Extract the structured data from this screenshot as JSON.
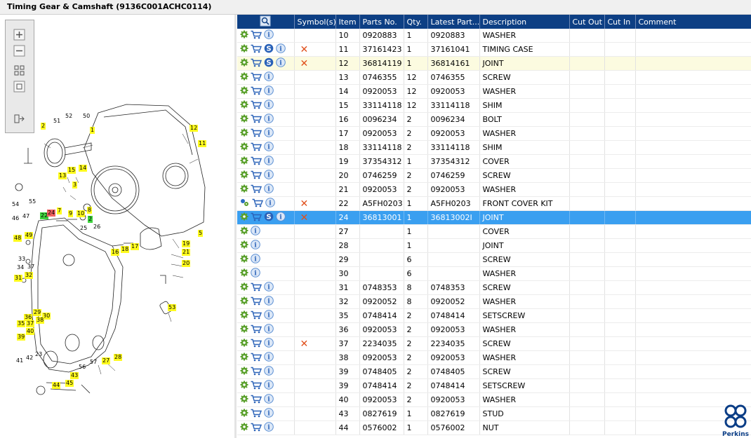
{
  "window": {
    "title": "Timing Gear & Camshaft (9136C001ACHC0114)"
  },
  "toolbar": {
    "buttons": [
      "zoom-in",
      "zoom-out",
      "fit-page",
      "actual-size",
      "toggle-panel"
    ]
  },
  "diagram": {
    "callouts": [
      {
        "text": "1",
        "style": "y"
      },
      {
        "text": "2",
        "style": "y"
      },
      {
        "text": "12",
        "style": "y"
      },
      {
        "text": "11",
        "style": "y"
      },
      {
        "text": "51",
        "style": "n"
      },
      {
        "text": "52",
        "style": "n"
      },
      {
        "text": "50",
        "style": "n"
      },
      {
        "text": "15",
        "style": "y"
      },
      {
        "text": "14",
        "style": "y"
      },
      {
        "text": "13",
        "style": "y"
      },
      {
        "text": "3",
        "style": "y"
      },
      {
        "text": "54",
        "style": "n"
      },
      {
        "text": "55",
        "style": "n"
      },
      {
        "text": "7",
        "style": "y"
      },
      {
        "text": "9",
        "style": "y"
      },
      {
        "text": "10",
        "style": "y"
      },
      {
        "text": "8",
        "style": "y"
      },
      {
        "text": "2",
        "style": "g"
      },
      {
        "text": "22",
        "style": "g"
      },
      {
        "text": "24",
        "style": "r"
      },
      {
        "text": "47",
        "style": "n"
      },
      {
        "text": "46",
        "style": "n"
      },
      {
        "text": "49",
        "style": "y"
      },
      {
        "text": "48",
        "style": "y"
      },
      {
        "text": "25",
        "style": "n"
      },
      {
        "text": "26",
        "style": "n"
      },
      {
        "text": "16",
        "style": "y"
      },
      {
        "text": "18",
        "style": "y"
      },
      {
        "text": "17",
        "style": "y"
      },
      {
        "text": "5",
        "style": "y"
      },
      {
        "text": "19",
        "style": "y"
      },
      {
        "text": "21",
        "style": "y"
      },
      {
        "text": "20",
        "style": "y"
      },
      {
        "text": "33",
        "style": "n"
      },
      {
        "text": "34",
        "style": "n"
      },
      {
        "text": "37",
        "style": "n"
      },
      {
        "text": "31",
        "style": "y"
      },
      {
        "text": "32",
        "style": "y"
      },
      {
        "text": "53",
        "style": "y"
      },
      {
        "text": "29",
        "style": "y"
      },
      {
        "text": "30",
        "style": "y"
      },
      {
        "text": "36",
        "style": "y"
      },
      {
        "text": "38",
        "style": "y"
      },
      {
        "text": "35",
        "style": "y"
      },
      {
        "text": "37",
        "style": "y"
      },
      {
        "text": "40",
        "style": "y"
      },
      {
        "text": "39",
        "style": "y"
      },
      {
        "text": "23",
        "style": "n"
      },
      {
        "text": "42",
        "style": "n"
      },
      {
        "text": "41",
        "style": "n"
      },
      {
        "text": "27",
        "style": "y"
      },
      {
        "text": "28",
        "style": "y"
      },
      {
        "text": "56",
        "style": "n"
      },
      {
        "text": "57",
        "style": "n"
      },
      {
        "text": "43",
        "style": "y"
      },
      {
        "text": "44",
        "style": "y"
      },
      {
        "text": "45",
        "style": "y"
      }
    ]
  },
  "table": {
    "columns": [
      "",
      "Symbol(s)",
      "Item",
      "Parts No.",
      "Qty.",
      "Latest Part...",
      "Description",
      "Cut Out",
      "Cut In",
      "Comment"
    ],
    "rows": [
      {
        "icons": [
          "gear",
          "cart",
          "info"
        ],
        "symbol": "",
        "item": "10",
        "part": "0920883",
        "qty": "1",
        "latest": "0920883",
        "desc": "WASHER"
      },
      {
        "icons": [
          "gear",
          "cart",
          "s",
          "info"
        ],
        "symbol": "x",
        "item": "11",
        "part": "37161423",
        "qty": "1",
        "latest": "37161041",
        "desc": "TIMING CASE"
      },
      {
        "icons": [
          "gear",
          "cart",
          "s",
          "info"
        ],
        "symbol": "x",
        "item": "12",
        "part": "36814119",
        "qty": "1",
        "latest": "36814161",
        "desc": "JOINT",
        "state": "hl"
      },
      {
        "icons": [
          "gear",
          "cart",
          "info"
        ],
        "symbol": "",
        "item": "13",
        "part": "0746355",
        "qty": "12",
        "latest": "0746355",
        "desc": "SCREW"
      },
      {
        "icons": [
          "gear",
          "cart",
          "info"
        ],
        "symbol": "",
        "item": "14",
        "part": "0920053",
        "qty": "12",
        "latest": "0920053",
        "desc": "WASHER"
      },
      {
        "icons": [
          "gear",
          "cart",
          "info"
        ],
        "symbol": "",
        "item": "15",
        "part": "33114118",
        "qty": "12",
        "latest": "33114118",
        "desc": "SHIM"
      },
      {
        "icons": [
          "gear",
          "cart",
          "info"
        ],
        "symbol": "",
        "item": "16",
        "part": "0096234",
        "qty": "2",
        "latest": "0096234",
        "desc": "BOLT"
      },
      {
        "icons": [
          "gear",
          "cart",
          "info"
        ],
        "symbol": "",
        "item": "17",
        "part": "0920053",
        "qty": "2",
        "latest": "0920053",
        "desc": "WASHER"
      },
      {
        "icons": [
          "gear",
          "cart",
          "info"
        ],
        "symbol": "",
        "item": "18",
        "part": "33114118",
        "qty": "2",
        "latest": "33114118",
        "desc": "SHIM"
      },
      {
        "icons": [
          "gear",
          "cart",
          "info"
        ],
        "symbol": "",
        "item": "19",
        "part": "37354312",
        "qty": "1",
        "latest": "37354312",
        "desc": "COVER"
      },
      {
        "icons": [
          "gear",
          "cart",
          "info"
        ],
        "symbol": "",
        "item": "20",
        "part": "0746259",
        "qty": "2",
        "latest": "0746259",
        "desc": "SCREW"
      },
      {
        "icons": [
          "gear",
          "cart",
          "info"
        ],
        "symbol": "",
        "item": "21",
        "part": "0920053",
        "qty": "2",
        "latest": "0920053",
        "desc": "WASHER"
      },
      {
        "icons": [
          "kit",
          "cart",
          "info"
        ],
        "symbol": "x",
        "item": "22",
        "part": "A5FH0203",
        "qty": "1",
        "latest": "A5FH0203",
        "desc": "FRONT COVER KIT"
      },
      {
        "icons": [
          "gear",
          "cart",
          "s",
          "info"
        ],
        "symbol": "x",
        "item": "24",
        "part": "36813001",
        "qty": "1",
        "latest": "36813002I",
        "desc": "JOINT",
        "state": "sel"
      },
      {
        "icons": [
          "gear",
          "info"
        ],
        "symbol": "",
        "item": "27",
        "part": "",
        "qty": "1",
        "latest": "",
        "desc": "COVER"
      },
      {
        "icons": [
          "gear",
          "info"
        ],
        "symbol": "",
        "item": "28",
        "part": "",
        "qty": "1",
        "latest": "",
        "desc": "JOINT"
      },
      {
        "icons": [
          "gear",
          "info"
        ],
        "symbol": "",
        "item": "29",
        "part": "",
        "qty": "6",
        "latest": "",
        "desc": "SCREW"
      },
      {
        "icons": [
          "gear",
          "info"
        ],
        "symbol": "",
        "item": "30",
        "part": "",
        "qty": "6",
        "latest": "",
        "desc": "WASHER"
      },
      {
        "icons": [
          "gear",
          "cart",
          "info"
        ],
        "symbol": "",
        "item": "31",
        "part": "0748353",
        "qty": "8",
        "latest": "0748353",
        "desc": "SCREW"
      },
      {
        "icons": [
          "gear",
          "cart",
          "info"
        ],
        "symbol": "",
        "item": "32",
        "part": "0920052",
        "qty": "8",
        "latest": "0920052",
        "desc": "WASHER"
      },
      {
        "icons": [
          "gear",
          "cart",
          "info"
        ],
        "symbol": "",
        "item": "35",
        "part": "0748414",
        "qty": "2",
        "latest": "0748414",
        "desc": "SETSCREW"
      },
      {
        "icons": [
          "gear",
          "cart",
          "info"
        ],
        "symbol": "",
        "item": "36",
        "part": "0920053",
        "qty": "2",
        "latest": "0920053",
        "desc": "WASHER"
      },
      {
        "icons": [
          "gear",
          "cart",
          "info"
        ],
        "symbol": "x",
        "item": "37",
        "part": "2234035",
        "qty": "2",
        "latest": "2234035",
        "desc": "SCREW"
      },
      {
        "icons": [
          "gear",
          "cart",
          "info"
        ],
        "symbol": "",
        "item": "38",
        "part": "0920053",
        "qty": "2",
        "latest": "0920053",
        "desc": "WASHER"
      },
      {
        "icons": [
          "gear",
          "cart",
          "info"
        ],
        "symbol": "",
        "item": "39",
        "part": "0748405",
        "qty": "2",
        "latest": "0748405",
        "desc": "SCREW"
      },
      {
        "icons": [
          "gear",
          "cart",
          "info"
        ],
        "symbol": "",
        "item": "39",
        "part": "0748414",
        "qty": "2",
        "latest": "0748414",
        "desc": "SETSCREW"
      },
      {
        "icons": [
          "gear",
          "cart",
          "info"
        ],
        "symbol": "",
        "item": "40",
        "part": "0920053",
        "qty": "2",
        "latest": "0920053",
        "desc": "WASHER"
      },
      {
        "icons": [
          "gear",
          "cart",
          "info"
        ],
        "symbol": "",
        "item": "43",
        "part": "0827619",
        "qty": "1",
        "latest": "0827619",
        "desc": "STUD"
      },
      {
        "icons": [
          "gear",
          "cart",
          "info"
        ],
        "symbol": "",
        "item": "44",
        "part": "0576002",
        "qty": "1",
        "latest": "0576002",
        "desc": "NUT"
      }
    ]
  },
  "branding": {
    "logo_text": "Perkins",
    "brand_color": "#0a3d86"
  },
  "colors": {
    "header_bg": "#0d3f84",
    "selected_row": "#3a9ff0",
    "highlight_row": "#fcfbe0",
    "symbol_x": "#e0501c",
    "callout_yellow": "#fffb1e"
  }
}
